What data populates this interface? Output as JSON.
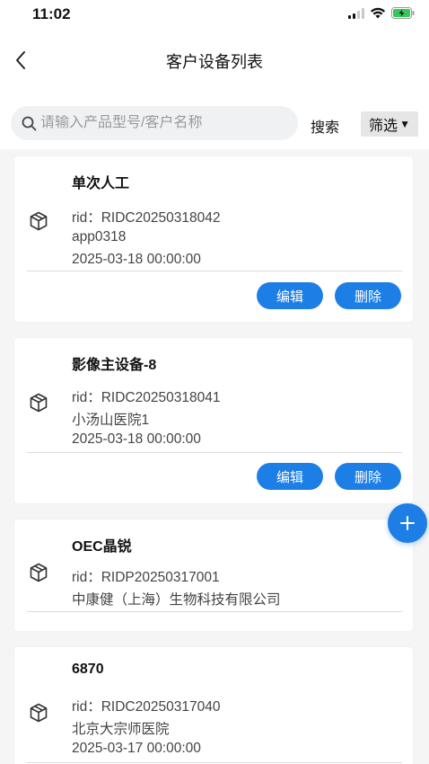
{
  "status_bar": {
    "time": "11:02"
  },
  "nav": {
    "title": "客户设备列表"
  },
  "search": {
    "placeholder": "请输入产品型号/客户名称",
    "search_label": "搜索",
    "filter_label": "筛选"
  },
  "devices": [
    {
      "name": "单次人工",
      "rid": "rid：RIDC20250318042",
      "customer": "app0318",
      "date": "2025-03-18 00:00:00",
      "edit_label": "编辑",
      "delete_label": "删除"
    },
    {
      "name": "影像主设备-8",
      "rid": "rid：RIDC20250318041",
      "customer": "小汤山医院1",
      "date": "2025-03-18 00:00:00",
      "edit_label": "编辑",
      "delete_label": "删除"
    },
    {
      "name": "OEC晶锐",
      "rid": "rid：RIDP20250317001",
      "customer": "中康健（上海）生物科技有限公司"
    },
    {
      "name": "6870",
      "rid": "rid：RIDC20250317040",
      "customer": "北京大宗师医院",
      "date": "2025-03-17 00:00:00"
    }
  ],
  "colors": {
    "accent": "#1d7fe6",
    "background": "#f5f5f5"
  },
  "icons": {
    "back": "chevron-left-icon",
    "search": "search-icon",
    "device": "cube-icon",
    "add": "plus-icon"
  }
}
